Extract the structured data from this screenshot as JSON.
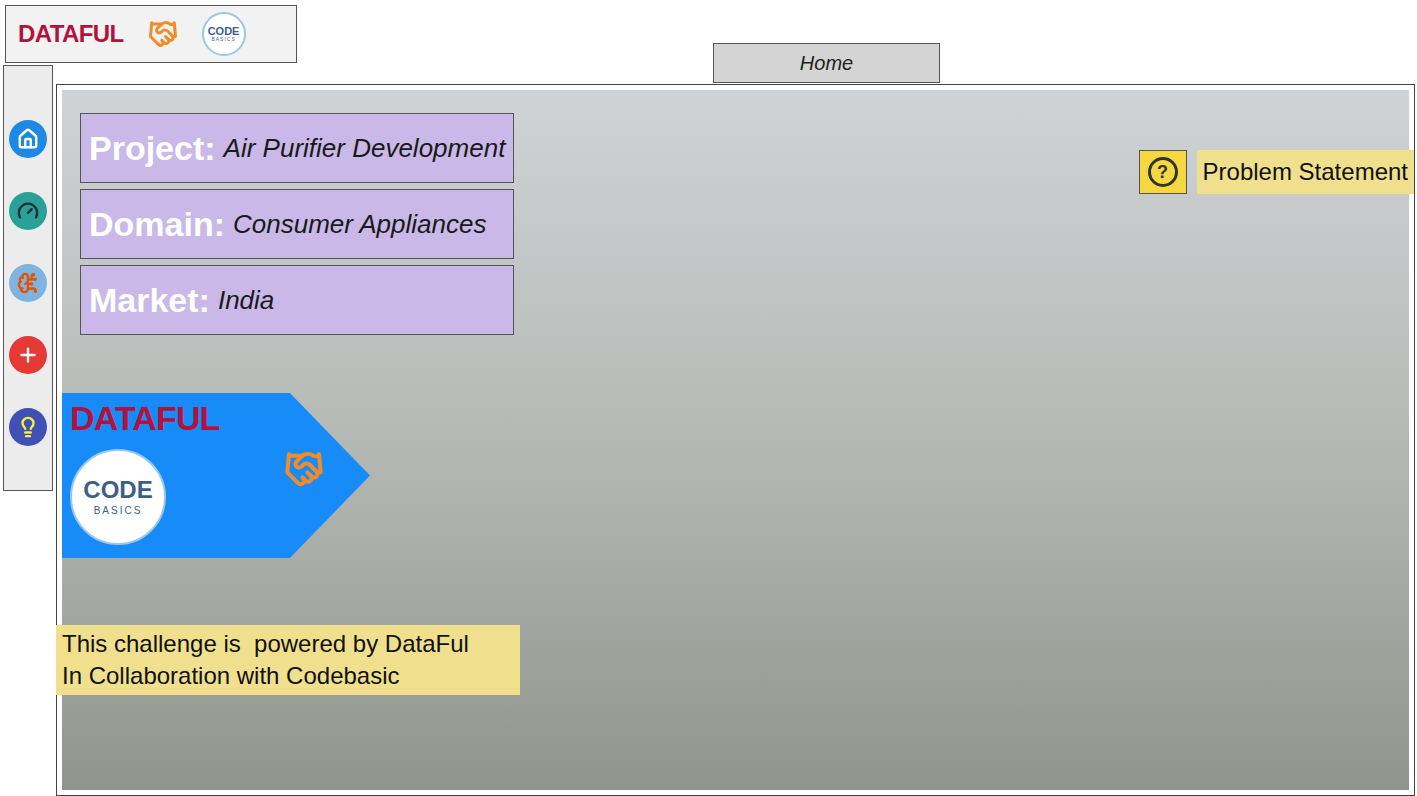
{
  "header": {
    "brand": "DATAFUL",
    "partner": {
      "top": "CODE",
      "bottom": "BASICS"
    }
  },
  "tabs": [
    {
      "label": "Home",
      "selected": true
    }
  ],
  "fields": [
    {
      "label": "Project:",
      "value": "Air Purifier Development"
    },
    {
      "label": "Domain:",
      "value": "Consumer Appliances"
    },
    {
      "label": "Market:",
      "value": "India"
    }
  ],
  "help": {
    "icon": "?",
    "label": "Problem Statement"
  },
  "banner": {
    "brand": "DATAFUL",
    "partner": {
      "top": "CODE",
      "bottom": "BASICS"
    }
  },
  "caption": [
    "This challenge is  powered by DataFul",
    "In Collaboration with Codebasic"
  ]
}
